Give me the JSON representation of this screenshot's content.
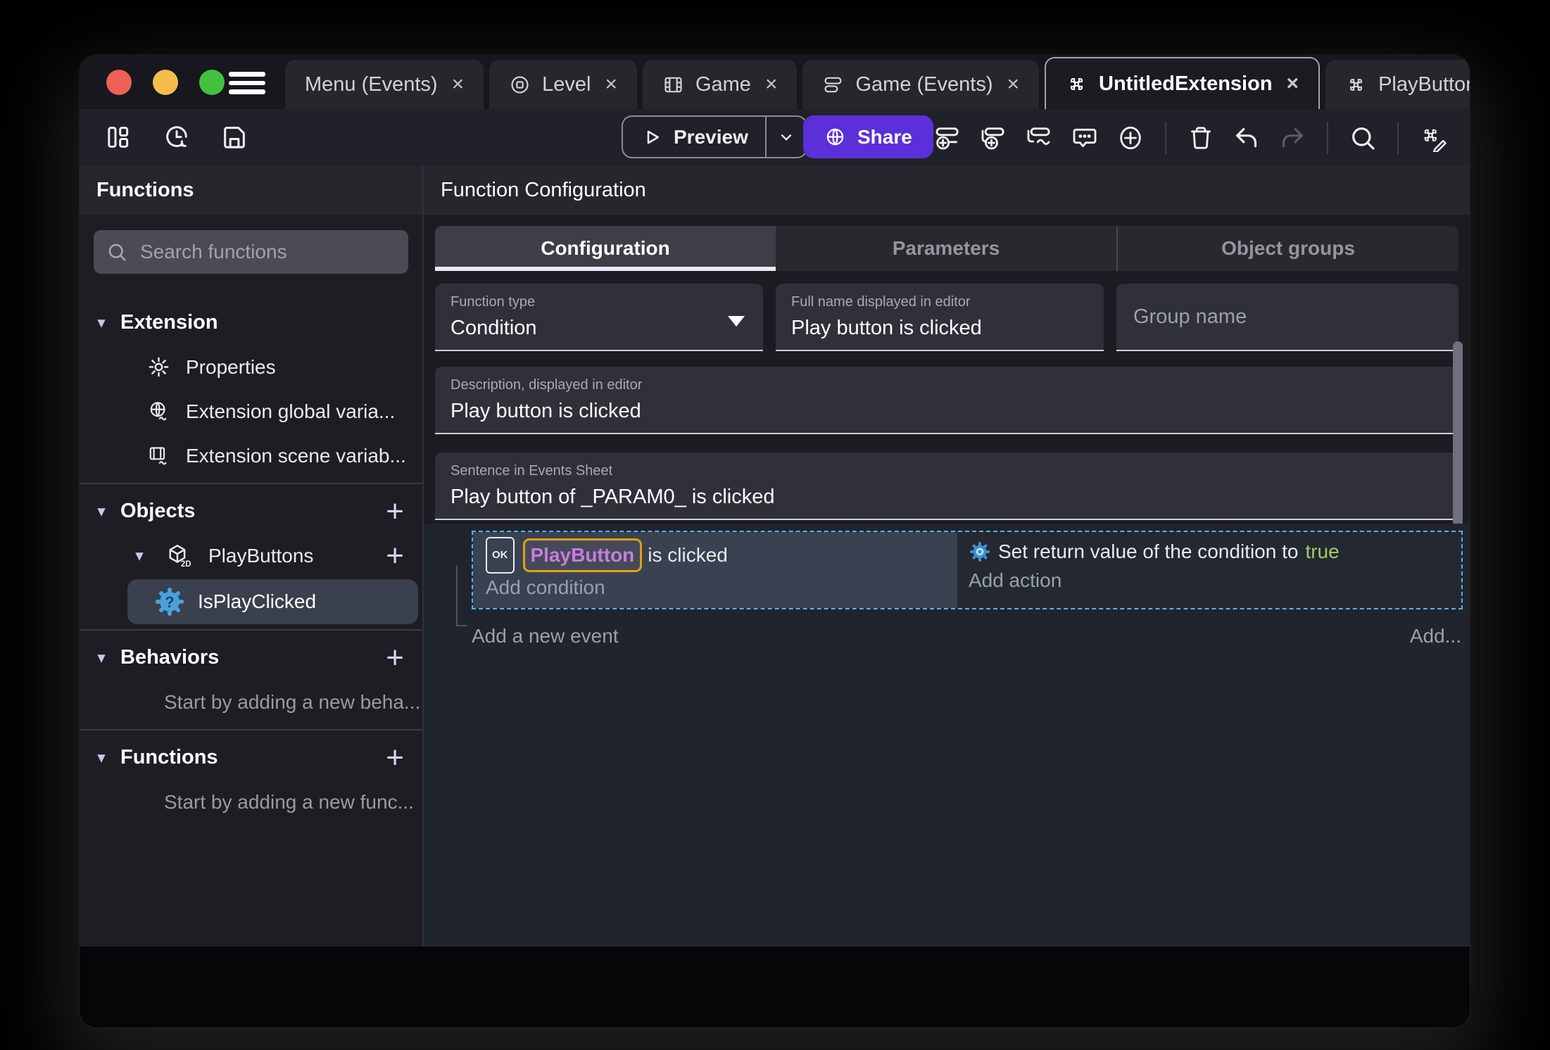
{
  "glyphs": {
    "close": "×",
    "plus": "+",
    "collapse_arrow": "▾",
    "ok": "OK",
    "question_mark": "?",
    "two_d": "2D"
  },
  "colors": {
    "share_purple": "#5b2fd9",
    "selection_blue": "#4fb3f0",
    "object_purple": "#c77ddb",
    "object_border_orange": "#e1a016",
    "boolean_green": "#a3cc6a",
    "tab_underline": "#ebe6f9",
    "function_icon_blue": "#4aa0dc"
  },
  "titlebar": {
    "tabs": [
      {
        "label": "Menu (Events)"
      },
      {
        "label": "Level"
      },
      {
        "label": "Game"
      },
      {
        "label": "Game (Events)"
      },
      {
        "label": "UntitledExtension"
      },
      {
        "label": "PlayButtons (Object)"
      }
    ]
  },
  "toolbar": {
    "preview": "Preview",
    "share": "Share"
  },
  "sidebar": {
    "title": "Functions",
    "search_placeholder": "Search functions",
    "sections": {
      "extension": {
        "label": "Extension",
        "items": [
          {
            "label": "Properties"
          },
          {
            "label": "Extension global varia..."
          },
          {
            "label": "Extension scene variab..."
          }
        ]
      },
      "objects": {
        "label": "Objects",
        "object": {
          "label": "PlayButtons"
        },
        "function": {
          "label": "IsPlayClicked"
        }
      },
      "behaviors": {
        "label": "Behaviors",
        "hint": "Start by adding a new beha..."
      },
      "functions": {
        "label": "Functions",
        "hint": "Start by adding a new func..."
      }
    }
  },
  "main": {
    "title": "Function Configuration",
    "tabs": [
      {
        "label": "Configuration"
      },
      {
        "label": "Parameters"
      },
      {
        "label": "Object groups"
      }
    ],
    "fields": {
      "function_type": {
        "label": "Function type",
        "value": "Condition"
      },
      "full_name": {
        "label": "Full name displayed in editor",
        "value": "Play button is clicked"
      },
      "group_name": {
        "placeholder": "Group name"
      },
      "description": {
        "label": "Description, displayed in editor",
        "value": "Play button is clicked"
      },
      "sentence": {
        "label": "Sentence in Events Sheet",
        "value": "Play button of _PARAM0_ is clicked"
      }
    },
    "events": {
      "condition": {
        "object_name": "PlayButton",
        "text": "is clicked",
        "placeholder": "Add condition"
      },
      "action": {
        "text": "Set return value of the condition to",
        "value": "true",
        "placeholder": "Add action"
      },
      "add_event_label": "Add a new event",
      "add_button_label": "Add..."
    }
  }
}
